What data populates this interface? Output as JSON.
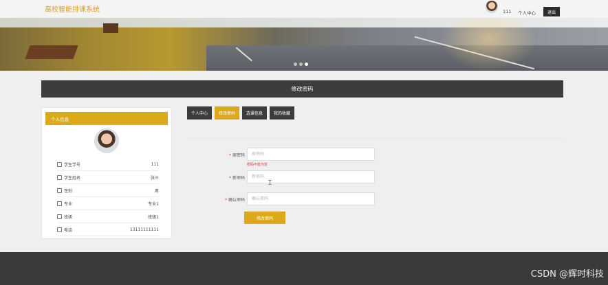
{
  "header": {
    "brand": "高校智能排课系统",
    "username": "111",
    "personal_center": "个人中心",
    "logout": "退出"
  },
  "page_title": "修改密码",
  "sidebar": {
    "title": "个人信息",
    "rows": [
      {
        "label": "学生学号",
        "value": "111"
      },
      {
        "label": "学生姓名",
        "value": "张三"
      },
      {
        "label": "性别",
        "value": "男"
      },
      {
        "label": "专业",
        "value": "专业1"
      },
      {
        "label": "班级",
        "value": "班级1"
      },
      {
        "label": "电话",
        "value": "13111111111"
      }
    ]
  },
  "tabs": [
    {
      "label": "个人中心",
      "active": false
    },
    {
      "label": "修改密码",
      "active": true
    },
    {
      "label": "选课信息",
      "active": false
    },
    {
      "label": "我的收藏",
      "active": false
    }
  ],
  "form": {
    "old_password": {
      "label": "原密码",
      "placeholder": "原密码",
      "value": ""
    },
    "error": "密码不能为空",
    "new_password": {
      "label": "新密码",
      "placeholder": "新密码",
      "value": ""
    },
    "confirm_password": {
      "label": "确认密码",
      "placeholder": "确认密码",
      "value": ""
    },
    "required_mark": "*",
    "submit": "修改密码"
  },
  "watermark": "CSDN @辉时科技",
  "colors": {
    "accent": "#dca91a",
    "dark": "#3b3b3b",
    "error": "#d33333"
  }
}
